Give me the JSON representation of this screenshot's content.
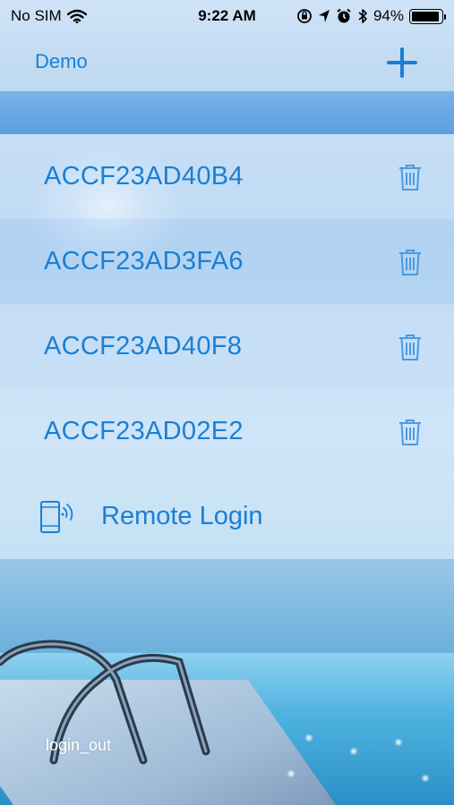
{
  "status_bar": {
    "carrier": "No SIM",
    "time": "9:22 AM",
    "battery_percent": "94%",
    "battery_level": 0.94,
    "icons": [
      "wifi-icon",
      "orientation-lock-icon",
      "location-arrow-icon",
      "alarm-icon",
      "bluetooth-icon",
      "battery-icon"
    ]
  },
  "nav": {
    "title": "Demo",
    "add_icon": "plus-icon"
  },
  "devices": [
    {
      "name": "ACCF23AD40B4",
      "delete_icon": "trash-icon"
    },
    {
      "name": "ACCF23AD3FA6",
      "delete_icon": "trash-icon"
    },
    {
      "name": "ACCF23AD40F8",
      "delete_icon": "trash-icon"
    },
    {
      "name": "ACCF23AD02E2",
      "delete_icon": "trash-icon"
    }
  ],
  "remote_login": {
    "label": "Remote Login",
    "icon": "phone-wireless-icon"
  },
  "footer": {
    "logout_label": "login_out"
  },
  "colors": {
    "accent": "#1a7fd4",
    "band": "#5c9ee0"
  }
}
